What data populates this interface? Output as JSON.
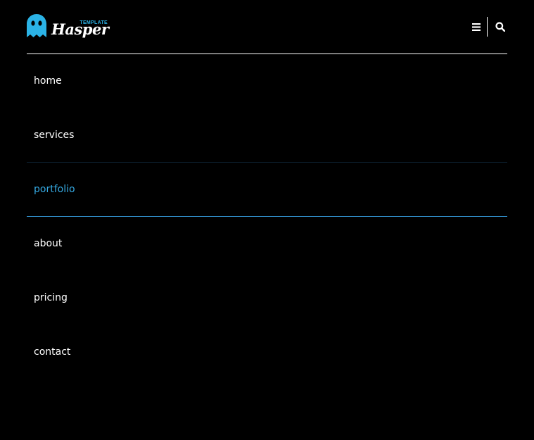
{
  "brand": {
    "name": "Hasper",
    "tagline": "TEMPLATE",
    "accent_color": "#2bb3e6"
  },
  "header": {
    "menu_icon": "hamburger-menu-icon",
    "search_icon": "search-icon"
  },
  "menu": {
    "items": [
      {
        "label": "home"
      },
      {
        "label": "services"
      },
      {
        "label": "portfolio",
        "active": true
      },
      {
        "label": "about"
      },
      {
        "label": "pricing"
      },
      {
        "label": "contact"
      }
    ],
    "text_color": "#ffffff",
    "active_color": "#35a9e2"
  }
}
